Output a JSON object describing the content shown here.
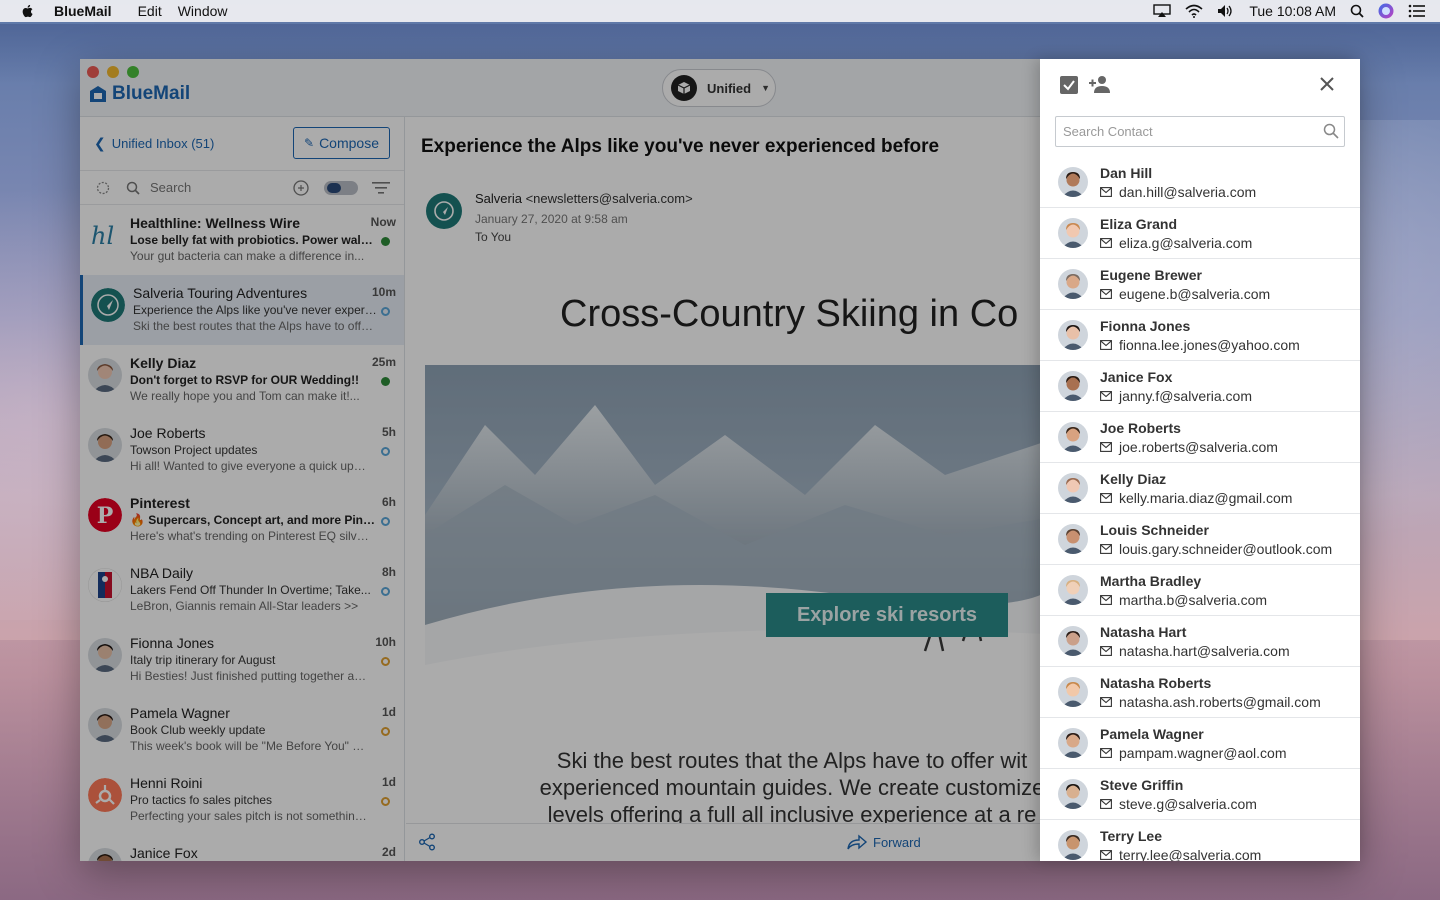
{
  "menubar": {
    "app_name": "BlueMail",
    "menus": [
      "Edit",
      "Window"
    ],
    "clock": "Tue 10:08 AM"
  },
  "window": {
    "brand": "BlueMail",
    "account_switch": "Unified"
  },
  "inbox": {
    "back_label": "Unified Inbox (51)",
    "compose_label": "Compose",
    "search_label": "Search",
    "items": [
      {
        "sender": "Healthline: Wellness Wire",
        "time": "Now",
        "subject": "Lose belly fat with probiotics. Power walking...",
        "preview": "Your gut bacteria can make a difference in...",
        "unread": true,
        "dot": "filled-green",
        "avatar": "hl-logo"
      },
      {
        "sender": "Salveria Touring Adventures",
        "time": "10m",
        "subject": "Experience the Alps like you've never experie...",
        "preview": "Ski the best routes that the Alps have to offer...",
        "unread": false,
        "dot": "ring-blue",
        "avatar": "salveria-logo"
      },
      {
        "sender": "Kelly Diaz",
        "time": "25m",
        "subject": "Don't forget to RSVP for OUR Wedding!!",
        "preview": "We really hope you and Tom can make it!...",
        "unread": true,
        "dot": "filled-green",
        "avatar": "person"
      },
      {
        "sender": "Joe Roberts",
        "time": "5h",
        "subject": "Towson Project updates",
        "preview": "Hi all! Wanted to give everyone a quick updat...",
        "unread": false,
        "dot": "ring-blue",
        "avatar": "person"
      },
      {
        "sender": "Pinterest",
        "time": "6h",
        "subject": "🔥 Supercars, Concept art, and more Pins...",
        "preview": "Here's what's trending on Pinterest EQ silver...",
        "unread": true,
        "dot": "ring-blue",
        "avatar": "pinterest-logo"
      },
      {
        "sender": "NBA Daily",
        "time": "8h",
        "subject": "Lakers Fend Off Thunder In Overtime; Take...",
        "preview": "LeBron, Giannis remain All-Star leaders >>",
        "unread": false,
        "dot": "ring-blue",
        "avatar": "nba-logo"
      },
      {
        "sender": "Fionna Jones",
        "time": "10h",
        "subject": "Italy trip itinerary for August",
        "preview": "Hi Besties! Just finished putting together an...",
        "unread": false,
        "dot": "ring-orange",
        "avatar": "person"
      },
      {
        "sender": "Pamela Wagner",
        "time": "1d",
        "subject": "Book Club weekly update",
        "preview": "This week's book will be \"Me Before You\" by...",
        "unread": false,
        "dot": "ring-orange",
        "avatar": "person"
      },
      {
        "sender": "Henni Roini",
        "time": "1d",
        "subject": "Pro tactics fo sales pitches",
        "preview": "Perfecting your sales pitch is not something...",
        "unread": false,
        "dot": "ring-orange",
        "avatar": "hubspot-logo"
      },
      {
        "sender": "Janice Fox",
        "time": "2d",
        "subject": "",
        "preview": "",
        "unread": false,
        "dot": "",
        "avatar": "person"
      }
    ]
  },
  "message": {
    "subject": "Experience the Alps like you've never experienced before",
    "from_name": "Salveria",
    "from_email": "<newsletters@salveria.com>",
    "date": "January 27, 2020 at 9:58 am",
    "to": "To You",
    "headline": "Cross-Country Skiing in Co",
    "cta": "Explore ski resorts",
    "body_lines": [
      "Ski the best routes that the Alps have to offer wit",
      "experienced mountain guides. We create customize",
      "levels offering a full all inclusive experience at a re"
    ],
    "forward_label": "Forward"
  },
  "contacts": {
    "search_placeholder": "Search Contact",
    "items": [
      {
        "name": "Dan Hill",
        "email": "dan.hill@salveria.com",
        "skin": "#b07a5a",
        "hair": "#2a1a12"
      },
      {
        "name": "Eliza Grand",
        "email": "eliza.g@salveria.com",
        "skin": "#f1c8b0",
        "hair": "#c98850"
      },
      {
        "name": "Eugene Brewer",
        "email": "eugene.b@salveria.com",
        "skin": "#d9a888",
        "hair": "#7a6a60"
      },
      {
        "name": "Fionna Jones",
        "email": "fionna.lee.jones@yahoo.com",
        "skin": "#e8c0a8",
        "hair": "#1e1612"
      },
      {
        "name": "Janice Fox",
        "email": "janny.f@salveria.com",
        "skin": "#a87050",
        "hair": "#2a1a10"
      },
      {
        "name": "Joe Roberts",
        "email": "joe.roberts@salveria.com",
        "skin": "#d8a280",
        "hair": "#3a2618"
      },
      {
        "name": "Kelly Diaz",
        "email": "kelly.maria.diaz@gmail.com",
        "skin": "#f0c8b4",
        "hair": "#9a6a50"
      },
      {
        "name": "Louis Schneider",
        "email": "louis.gary.schneider@outlook.com",
        "skin": "#c89070",
        "hair": "#5a4030"
      },
      {
        "name": "Martha Bradley",
        "email": "martha.b@salveria.com",
        "skin": "#f0d0b8",
        "hair": "#d8b080"
      },
      {
        "name": "Natasha Hart",
        "email": "natasha.hart@salveria.com",
        "skin": "#caa08a",
        "hair": "#2a1c16"
      },
      {
        "name": "Natasha Roberts",
        "email": "natasha.ash.roberts@gmail.com",
        "skin": "#f2c8a8",
        "hair": "#c8884a"
      },
      {
        "name": "Pamela Wagner",
        "email": "pampam.wagner@aol.com",
        "skin": "#d8a888",
        "hair": "#2a1a14"
      },
      {
        "name": "Steve Griffin",
        "email": "steve.g@salveria.com",
        "skin": "#d8b090",
        "hair": "#1a1410"
      },
      {
        "name": "Terry Lee",
        "email": "terry.lee@salveria.com",
        "skin": "#c8946e",
        "hair": "#3a2a20"
      }
    ]
  }
}
